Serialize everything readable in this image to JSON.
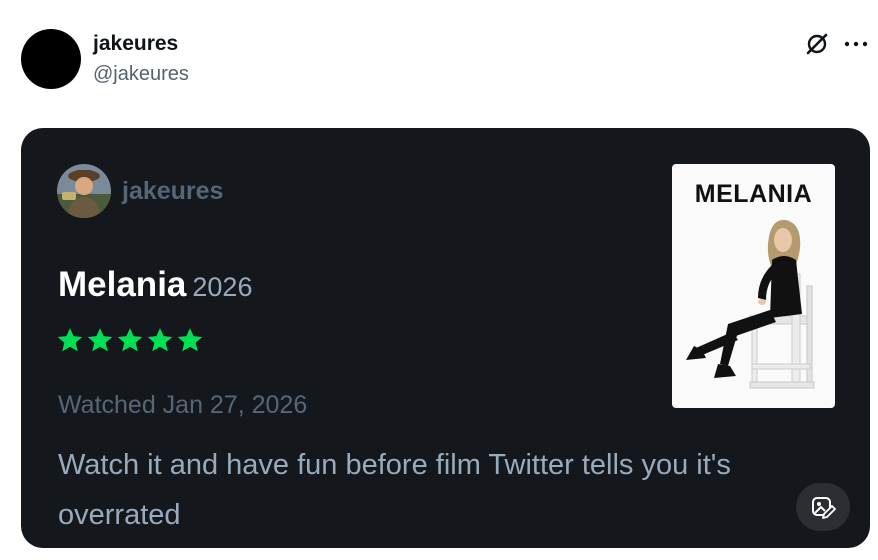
{
  "tweet": {
    "display_name": "jakeures",
    "handle": "@jakeures"
  },
  "actions": {
    "grok_icon": "grok-icon",
    "more_icon": "more-horizontal-icon"
  },
  "review_card": {
    "reviewer": "jakeures",
    "film_title": "Melania",
    "film_year": "2026",
    "rating_stars": 5,
    "watched_label": "Watched Jan 27, 2026",
    "review_text": "Watch it and have fun before film Twitter tells you it's overrated",
    "poster_title": "MELANIA",
    "star_color": "#00e054",
    "card_bg": "#14181c"
  }
}
